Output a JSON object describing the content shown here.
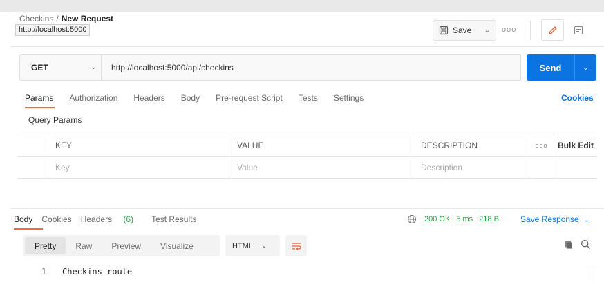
{
  "header": {
    "breadcrumb_parent": "Checkins",
    "breadcrumb_sep": "/",
    "breadcrumb_current": "New Request",
    "tooltip": "http://localhost:5000",
    "save_label": "Save",
    "more": "ooo"
  },
  "request": {
    "method": "GET",
    "url": "http://localhost:5000/api/checkins",
    "send_label": "Send"
  },
  "tabs": [
    {
      "label": "Params"
    },
    {
      "label": "Authorization"
    },
    {
      "label": "Headers"
    },
    {
      "label": "Body"
    },
    {
      "label": "Pre-request Script"
    },
    {
      "label": "Tests"
    },
    {
      "label": "Settings"
    }
  ],
  "cookies_label": "Cookies",
  "query_params": {
    "title": "Query Params",
    "headers": {
      "key": "KEY",
      "value": "VALUE",
      "description": "DESCRIPTION",
      "more": "ooo",
      "bulk_edit": "Bulk Edit"
    },
    "placeholders": {
      "key": "Key",
      "value": "Value",
      "description": "Description"
    }
  },
  "response": {
    "tabs": {
      "body": "Body",
      "cookies": "Cookies",
      "headers": "Headers",
      "headers_count": "(6)",
      "test_results": "Test Results"
    },
    "status": "200 OK",
    "time": "5 ms",
    "size": "218 B",
    "save_response": "Save Response",
    "views": [
      "Pretty",
      "Raw",
      "Preview",
      "Visualize"
    ],
    "format": "HTML",
    "lines": [
      {
        "n": "1",
        "text": "Checkins route"
      }
    ]
  },
  "colors": {
    "accent": "#0c73e2",
    "tab_underline": "#f26b3a",
    "status_ok": "#28a745"
  }
}
